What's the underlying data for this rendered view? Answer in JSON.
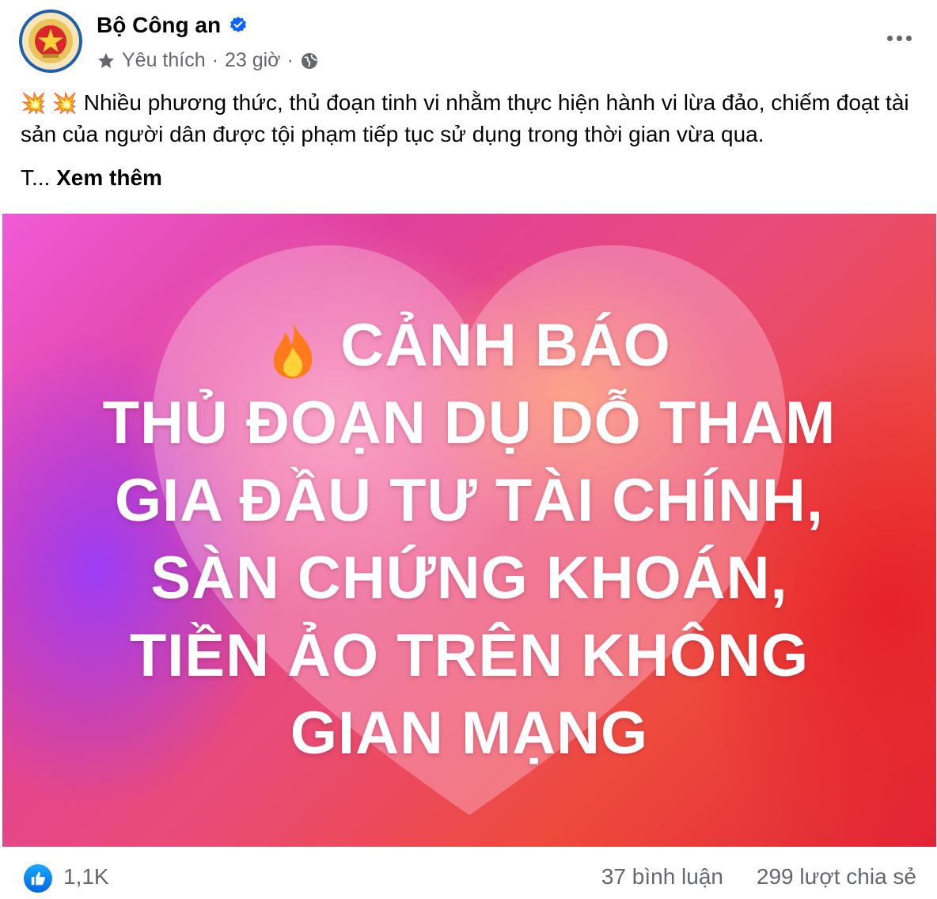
{
  "post": {
    "page_name": "Bộ Công an",
    "meta_prefix": "Yêu thích",
    "separator": " · ",
    "time": "23 giờ",
    "separator2": " ·",
    "text_emojis": "💥 💥",
    "text": "Nhiều phương thức, thủ đoạn tinh vi nhằm thực hiện hành vi lừa đảo, chiếm đoạt tài sản của người dân được tội phạm tiếp tục sử dụng trong thời gian vừa qua.",
    "truncated_text": "T...",
    "see_more": "Xem thêm"
  },
  "image_banner": {
    "line1": "CẢNH BÁO",
    "line2": "THỦ ĐOẠN DỤ DỖ THAM",
    "line3": "GIA ĐẦU TƯ TÀI CHÍNH,",
    "line4": "SÀN CHỨNG KHOÁN,",
    "line5": "TIỀN ẢO TRÊN KHÔNG",
    "line6": "GIAN MẠNG"
  },
  "stats": {
    "likes": "1,1K",
    "comments": "37 bình luận",
    "shares": "299 lượt chia sẻ"
  },
  "colors": {
    "verified": "#0866ff",
    "secondary_text": "#65676b",
    "like_blue": "#0866ff"
  }
}
